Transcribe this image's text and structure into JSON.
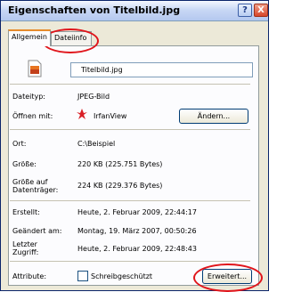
{
  "window": {
    "title": "Eigenschaften von Titelbild.jpg",
    "help_label": "?",
    "close_label": "X"
  },
  "tabs": [
    {
      "label": "Allgemein"
    },
    {
      "label": "Dateiinfo"
    }
  ],
  "general": {
    "filename": "Titelbild.jpg",
    "file_type_label": "Dateityp:",
    "file_type_value": "JPEG-Bild",
    "opens_with_label": "Öffnen mit:",
    "opens_with_value": "IrfanView",
    "change_button": "Ändern...",
    "location_label": "Ort:",
    "location_value": "C:\\Beispiel",
    "size_label": "Größe:",
    "size_value": "220 KB (225.751 Bytes)",
    "size_on_disk_label_line1": "Größe auf",
    "size_on_disk_label_line2": "Datenträger:",
    "size_on_disk_value": "224 KB (229.376 Bytes)",
    "created_label": "Erstellt:",
    "created_value": "Heute, 2. Februar 2009, 22:44:17",
    "modified_label": "Geändert am:",
    "modified_value": "Montag, 19. März 2007, 00:50:26",
    "accessed_label_line1": "Letzter",
    "accessed_label_line2": "Zugriff:",
    "accessed_value": "Heute, 2. Februar 2009, 22:48:43",
    "attributes_label": "Attribute:",
    "readonly_label": "Schreibgeschützt",
    "advanced_button": "Erweitert..."
  },
  "colors": {
    "highlight_ring": "#e0151b",
    "titlebar": "#c9d8f5"
  }
}
